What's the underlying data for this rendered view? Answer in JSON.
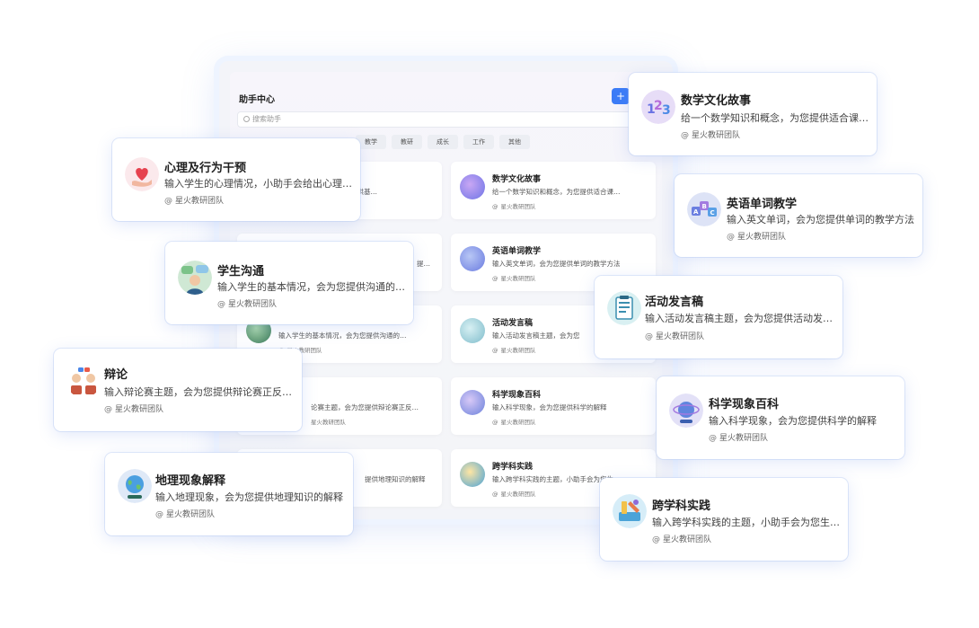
{
  "window": {
    "title": "助手中心",
    "add_label": "+",
    "search_placeholder": "搜索助手",
    "tabs": [
      "教学",
      "教研",
      "成长",
      "工作",
      "其他"
    ]
  },
  "team_label": "星火教研团队",
  "mini_cards": [
    {
      "title": "",
      "desc": "称，为您提供基…"
    },
    {
      "title": "数学文化故事",
      "desc": "给一个数学知识和概念，为您提供适合课…"
    },
    {
      "title": "",
      "desc": "提…"
    },
    {
      "title": "英语单词教学",
      "desc": "输入英文单词，会为您提供单词的教学方法"
    },
    {
      "title": "",
      "desc": "输入学生的基本情况，会为您提供沟通的…"
    },
    {
      "title": "活动发言稿",
      "desc": "输入活动发言稿主题，会为您"
    },
    {
      "title": "",
      "desc": "论赛主题，会为您提供辩论赛正反…"
    },
    {
      "title": "科学现象百科",
      "desc": "输入科学现象，会为您提供科学的解释"
    },
    {
      "title": "",
      "desc": "提供地理知识的解释"
    },
    {
      "title": "跨学科实践",
      "desc": "输入跨学科实践的主题，小助手会为您生…"
    }
  ],
  "cards": [
    {
      "id": "psychology",
      "title": "心理及行为干预",
      "desc": "输入学生的心理情况，小助手会给出心理…",
      "icon": "heart-hand-icon"
    },
    {
      "id": "communication",
      "title": "学生沟通",
      "desc": "输入学生的基本情况，会为您提供沟通的…",
      "icon": "chat-people-icon"
    },
    {
      "id": "debate",
      "title": "辩论",
      "desc": "输入辩论赛主题，会为您提供辩论赛正反…",
      "icon": "debate-people-icon"
    },
    {
      "id": "geography",
      "title": "地理现象解释",
      "desc": "输入地理现象，会为您提供地理知识的解释",
      "icon": "globe-icon"
    },
    {
      "id": "math",
      "title": "数学文化故事",
      "desc": "给一个数学知识和概念，为您提供适合课…",
      "icon": "numbers-icon"
    },
    {
      "id": "english",
      "title": "英语单词教学",
      "desc": "输入英文单词，会为您提供单词的教学方法",
      "icon": "abc-blocks-icon"
    },
    {
      "id": "speech",
      "title": "活动发言稿",
      "desc": "输入活动发言稿主题，会为您提供活动发…",
      "icon": "document-icon"
    },
    {
      "id": "science",
      "title": "科学现象百科",
      "desc": "输入科学现象，会为您提供科学的解释",
      "icon": "atom-globe-icon"
    },
    {
      "id": "interdisciplinary",
      "title": "跨学科实践",
      "desc": "输入跨学科实践的主题，小助手会为您生…",
      "icon": "tools-icon"
    }
  ]
}
